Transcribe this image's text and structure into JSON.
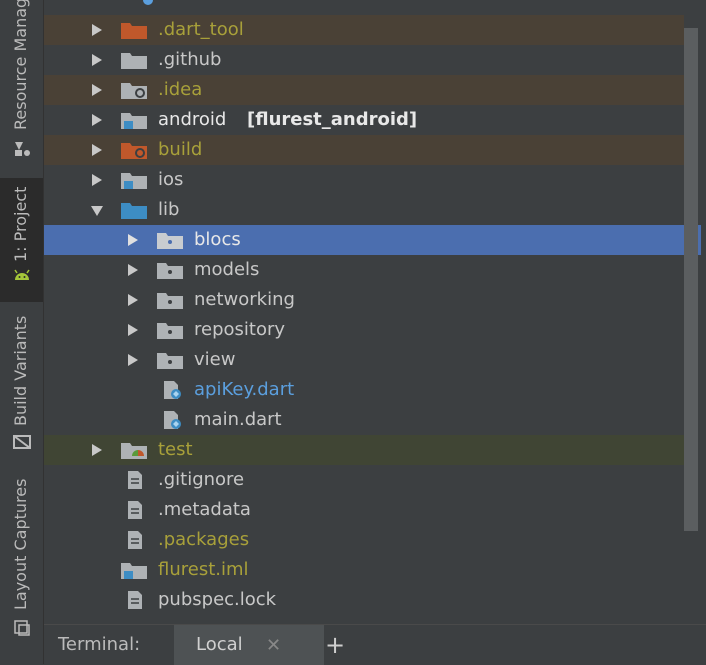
{
  "sidebar": {
    "tabs": [
      {
        "label": "Resource Manager"
      },
      {
        "label": "1: Project"
      },
      {
        "label": "Build Variants"
      },
      {
        "label": "Layout Captures"
      }
    ]
  },
  "tree": {
    "rows": [
      {
        "label": ".dart_tool"
      },
      {
        "label": ".github"
      },
      {
        "label": ".idea"
      },
      {
        "label": "android",
        "module": "[flurest_android]"
      },
      {
        "label": "build"
      },
      {
        "label": "ios"
      },
      {
        "label": "lib"
      },
      {
        "label": "blocs"
      },
      {
        "label": "models"
      },
      {
        "label": "networking"
      },
      {
        "label": "repository"
      },
      {
        "label": "view"
      },
      {
        "label": "apiKey.dart"
      },
      {
        "label": "main.dart"
      },
      {
        "label": "test"
      },
      {
        "label": ".gitignore"
      },
      {
        "label": ".metadata"
      },
      {
        "label": ".packages"
      },
      {
        "label": "flurest.iml"
      },
      {
        "label": "pubspec.lock"
      }
    ]
  },
  "bottom": {
    "terminal_label": "Terminal:",
    "tab_label": "Local",
    "close_glyph": "✕",
    "new_tab_glyph": "+"
  },
  "colors": {
    "background": "#3c3f41",
    "selection": "#4b6eaf",
    "ignored_text": "#a8a03a",
    "modified_text": "#5b9fde",
    "excluded_highlight": "#4a4136",
    "test_highlight": "#404534",
    "folder_blue": "#3d8dc4",
    "folder_orange": "#c0582b"
  }
}
